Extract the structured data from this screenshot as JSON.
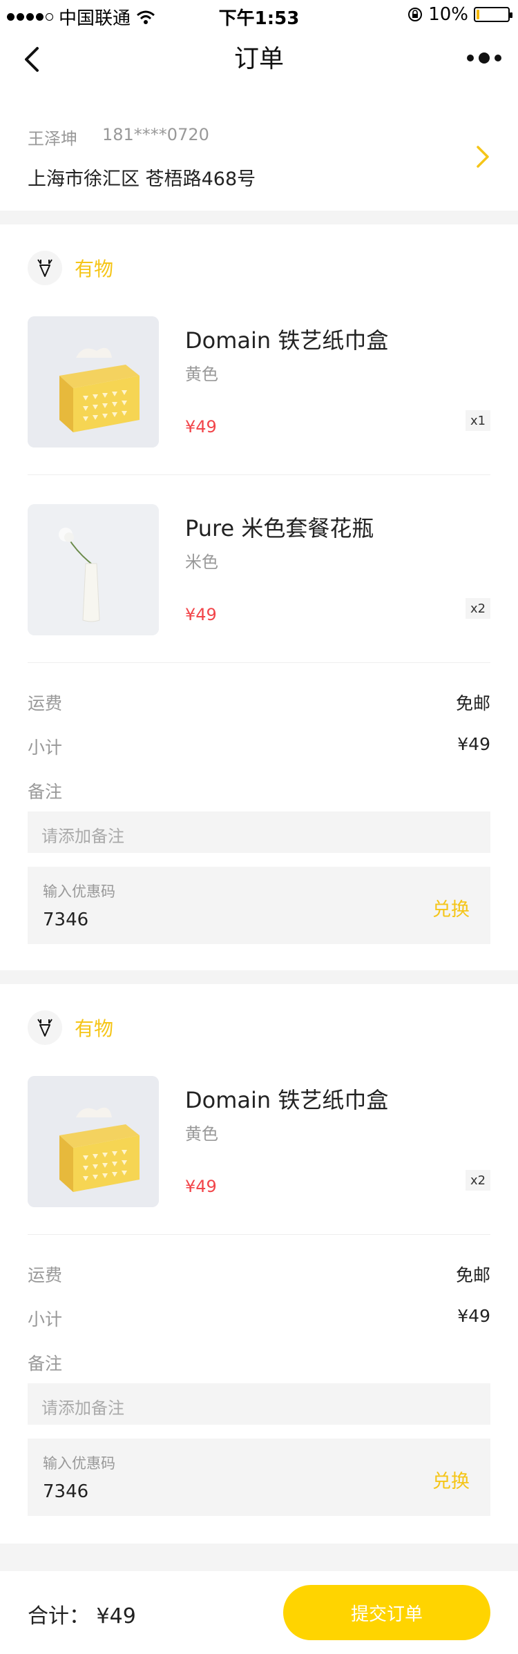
{
  "status_bar": {
    "carrier": "中国联通",
    "time": "下午1:53",
    "battery": "10%",
    "battery_level": 0.1
  },
  "nav": {
    "title": "订单"
  },
  "address": {
    "name": "王泽坤",
    "phone": "181****0720",
    "line": "上海市徐汇区 苍梧路468号"
  },
  "stores": [
    {
      "name": "有物",
      "items": [
        {
          "name": "Domain 铁艺纸巾盒",
          "variant": "黄色",
          "price": "¥49",
          "qty": "x1"
        },
        {
          "name": "Pure 米色套餐花瓶",
          "variant": "米色",
          "price": "¥49",
          "qty": "x2"
        }
      ],
      "shipping_label": "运费",
      "shipping_value": "免邮",
      "subtotal_label": "小计",
      "subtotal_value": "¥49",
      "remark_label": "备注",
      "remark_placeholder": "请添加备注",
      "coupon_label": "输入优惠码",
      "coupon_value": "7346",
      "coupon_button": "兑换"
    },
    {
      "name": "有物",
      "items": [
        {
          "name": "Domain 铁艺纸巾盒",
          "variant": "黄色",
          "price": "¥49",
          "qty": "x2"
        }
      ],
      "shipping_label": "运费",
      "shipping_value": "免邮",
      "subtotal_label": "小计",
      "subtotal_value": "¥49",
      "remark_label": "备注",
      "remark_placeholder": "请添加备注",
      "coupon_label": "输入优惠码",
      "coupon_value": "7346",
      "coupon_button": "兑换"
    }
  ],
  "footer": {
    "total": "合计： ¥49",
    "submit": "提交订单"
  },
  "colors": {
    "accent": "#ffd400",
    "price": "#f2454a",
    "store": "#f5c518"
  }
}
